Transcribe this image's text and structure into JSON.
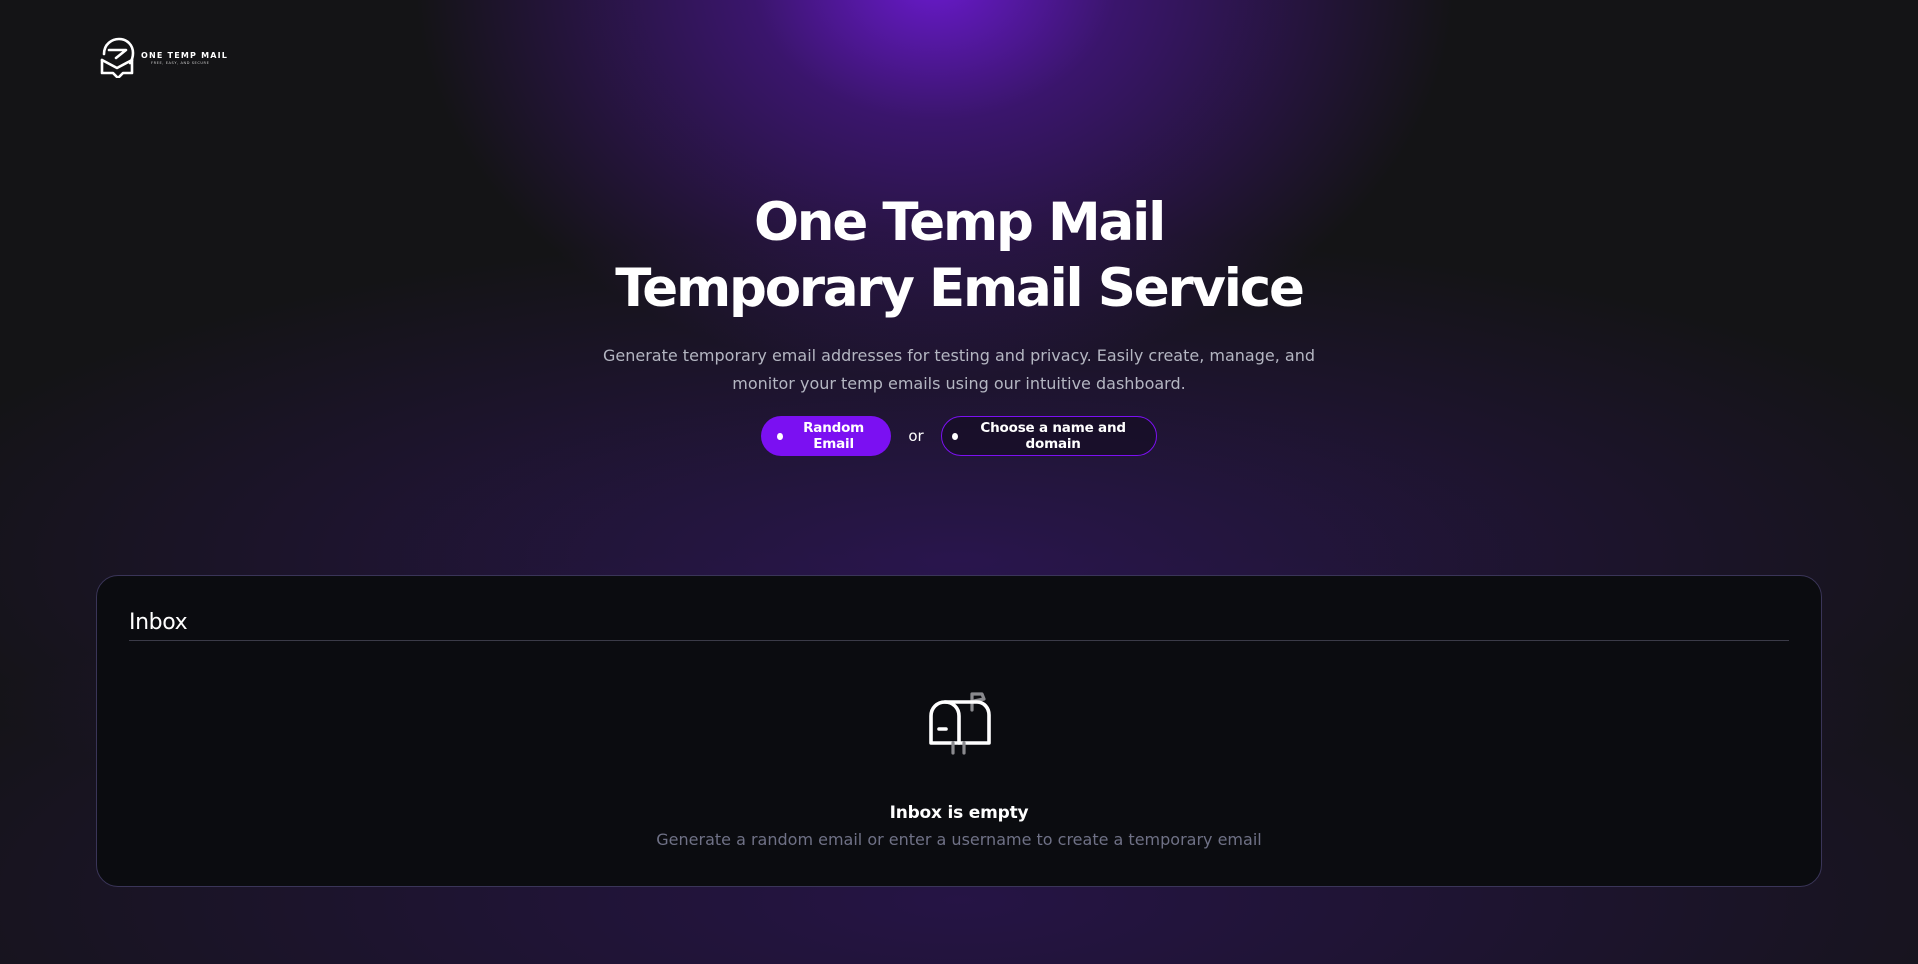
{
  "header": {
    "logo_name": "ONE TEMP MAIL",
    "logo_tagline": "FREE, EASY, AND SECURE",
    "logo_icon": "mail-chat-icon"
  },
  "hero": {
    "title_line1": "One Temp Mail",
    "title_line2": "Temporary Email Service",
    "description": "Generate temporary email addresses for testing and privacy. Easily create, manage, and monitor your temp emails using our intuitive dashboard.",
    "random_button_label": "Random Email",
    "or_label": "or",
    "custom_button_label": "Choose a name and domain"
  },
  "inbox": {
    "title": "Inbox",
    "empty_icon": "mailbox-icon",
    "empty_title": "Inbox is empty",
    "empty_subtitle": "Generate a random email or enter a username to create a temporary email"
  },
  "colors": {
    "accent": "#7b10f2",
    "background": "#141416",
    "card_background": "#0b0c10",
    "muted_text": "#6f7186"
  }
}
